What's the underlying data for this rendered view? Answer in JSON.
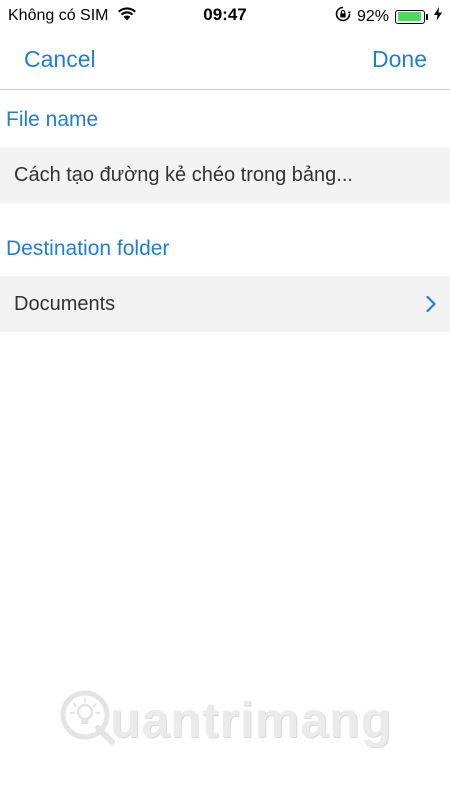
{
  "status_bar": {
    "carrier": "Không có SIM",
    "time": "09:47",
    "battery_percent": "92%",
    "battery_level": 0.92,
    "icons": [
      "wifi-icon",
      "rotation-lock-icon",
      "battery-icon",
      "charging-bolt-icon"
    ]
  },
  "nav": {
    "cancel_label": "Cancel",
    "done_label": "Done"
  },
  "file_name": {
    "label": "File name",
    "value": "Cách tạo đường kẻ chéo trong bảng..."
  },
  "destination": {
    "label": "Destination folder",
    "value": "Documents",
    "icon": "chevron-right-icon"
  },
  "watermark": {
    "text": "uantrimang"
  },
  "colors": {
    "accent": "#1f7ed9",
    "field_background": "#f3f3f3",
    "battery": "#4cd964"
  }
}
